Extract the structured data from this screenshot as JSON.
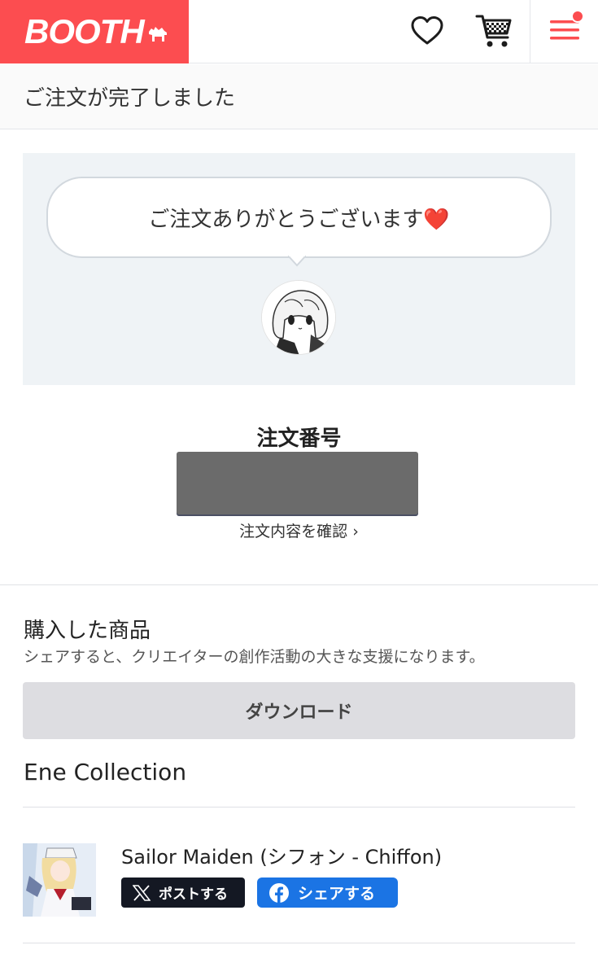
{
  "header": {
    "logo_text": "BOOTH",
    "brand_color": "#fc4d50",
    "icons": [
      "heart-icon",
      "cart-icon",
      "menu-icon"
    ]
  },
  "page_title": "ご注文が完了しました",
  "thanks": {
    "message": "ご注文ありがとうございます❤️"
  },
  "order": {
    "label": "注文番号",
    "detail_link": "注文内容を確認 ›"
  },
  "purchased": {
    "title": "購入した商品",
    "subtitle": "シェアすると、クリエイターの創作活動の大きな支援になります。",
    "download_label": "ダウンロード",
    "shop_name": "Ene Collection",
    "items": [
      {
        "title": "Sailor Maiden (シフォン - Chiffon)",
        "post_label": "ポストする",
        "share_label": "シェアする"
      }
    ]
  }
}
